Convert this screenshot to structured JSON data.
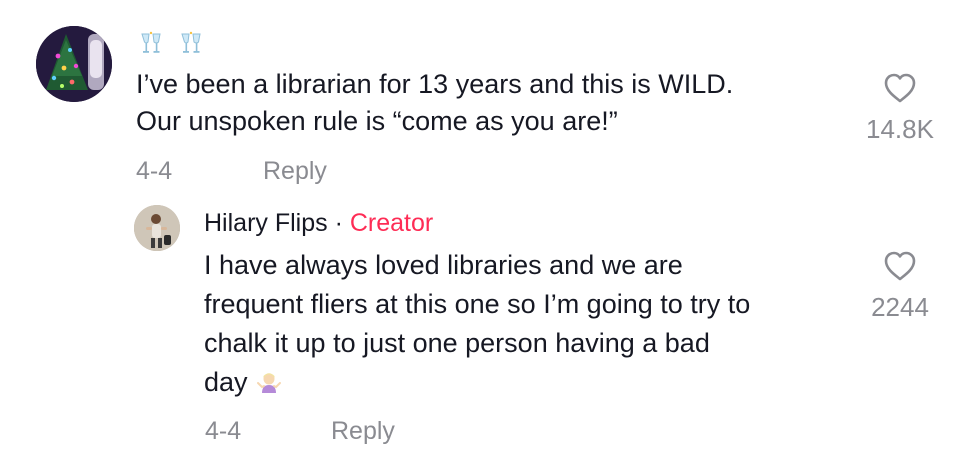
{
  "comment": {
    "avatar_icon": "user-avatar-christmas-tree",
    "emojis": [
      "clinking-glasses-icon",
      "clinking-glasses-icon"
    ],
    "lines": [
      "I’ve been a librarian for 13 years and this is WILD.",
      "Our unspoken rule is “come as you are!”"
    ],
    "date": "4-4",
    "reply_label": "Reply",
    "likes": "14.8K"
  },
  "reply": {
    "avatar_icon": "creator-avatar",
    "username": "Hilary Flips",
    "separator": " · ",
    "badge": "Creator",
    "lines": [
      "I have always loved libraries and we are",
      "frequent fliers at this one so I’m going to try to",
      "chalk it up to just one person having a bad",
      "day"
    ],
    "trailing_emoji": "person-shrugging-icon",
    "date": "4-4",
    "reply_label": "Reply",
    "likes": "2244"
  },
  "colors": {
    "text": "#161823",
    "muted": "#8a8b91",
    "creator": "#fe2c55"
  }
}
